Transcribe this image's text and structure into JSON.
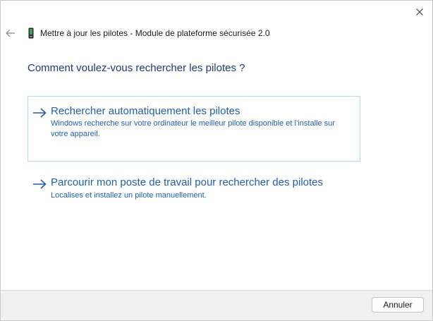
{
  "window": {
    "title": "Mettre à jour les pilotes - Module de plateforme sécurisée 2.0"
  },
  "icons": {
    "close": "close-icon",
    "back": "back-arrow-icon",
    "device": "device-icon",
    "option_arrow": "right-arrow-icon"
  },
  "colors": {
    "heading": "#1b3a7a",
    "link": "#1f5fb0",
    "option_border": "#b9d7ee",
    "footer_bg": "#f0f0f0"
  },
  "main": {
    "heading": "Comment voulez-vous rechercher les pilotes ?",
    "options": [
      {
        "title": "Rechercher automatiquement les pilotes",
        "description": "Windows recherche sur votre ordinateur le meilleur pilote disponible et l’installe sur votre appareil."
      },
      {
        "title": "Parcourir mon poste de travail pour rechercher des pilotes",
        "description": "Localises et installez un pilote manuellement."
      }
    ]
  },
  "footer": {
    "cancel_label": "Annuler"
  }
}
